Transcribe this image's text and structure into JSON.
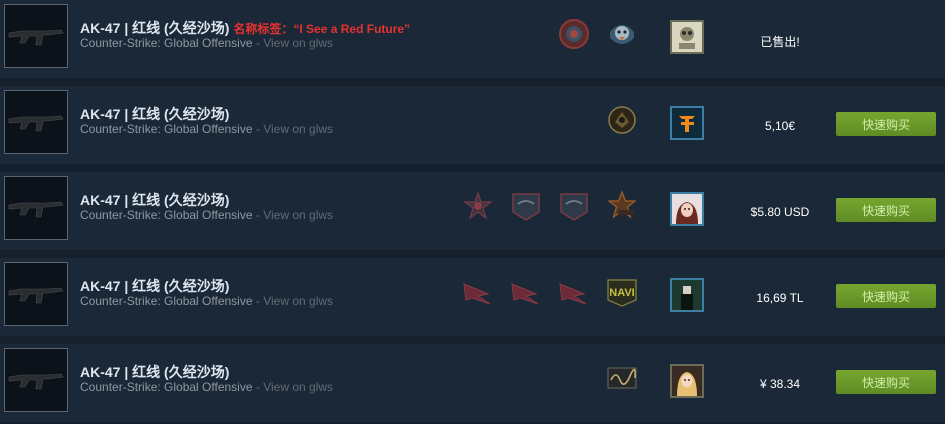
{
  "listings": [
    {
      "item_name": "AK-47 | 红线 (久经沙场)",
      "name_tag": "名称标签：“I See a Red Future”",
      "game": "Counter-Strike: Global Offensive",
      "separator": "-",
      "glws_link": "View on glws",
      "stickers": [
        "round-badge-sticker",
        "penguin-sticker"
      ],
      "price": "已售出!",
      "buy_label": ""
    },
    {
      "item_name": "AK-47 | 红线 (久经沙场)",
      "name_tag": "",
      "game": "Counter-Strike: Global Offensive",
      "separator": "-",
      "glws_link": "View on glws",
      "stickers": [
        "team-logo-sticker"
      ],
      "price": "5,10€",
      "buy_label": "快速购买"
    },
    {
      "item_name": "AK-47 | 红线 (久经沙场)",
      "name_tag": "",
      "game": "Counter-Strike: Global Offensive",
      "separator": "-",
      "glws_link": "View on glws",
      "stickers": [
        "star-logo-sticker",
        "shield-sticker",
        "shield-sticker",
        "open-star-sticker"
      ],
      "price": "$5.80 USD",
      "buy_label": "快速购买"
    },
    {
      "item_name": "AK-47 | 红线 (久经沙场)",
      "name_tag": "",
      "game": "Counter-Strike: Global Offensive",
      "separator": "-",
      "glws_link": "View on glws",
      "stickers": [
        "wing-sticker",
        "wing-sticker",
        "wing-sticker",
        "navi-sticker"
      ],
      "price": "16,69 TL",
      "buy_label": "快速购买"
    },
    {
      "item_name": "AK-47 | 红线 (久经沙场)",
      "name_tag": "",
      "game": "Counter-Strike: Global Offensive",
      "separator": "-",
      "glws_link": "View on glws",
      "stickers": [
        "signature-sticker"
      ],
      "price": "¥ 38.34",
      "buy_label": "快速购买"
    }
  ],
  "colors": {
    "page_bg": "#16202d",
    "row_bg": "#1b2838",
    "name_tag": "#e8322f",
    "buy_button": "#6a9a2c"
  }
}
